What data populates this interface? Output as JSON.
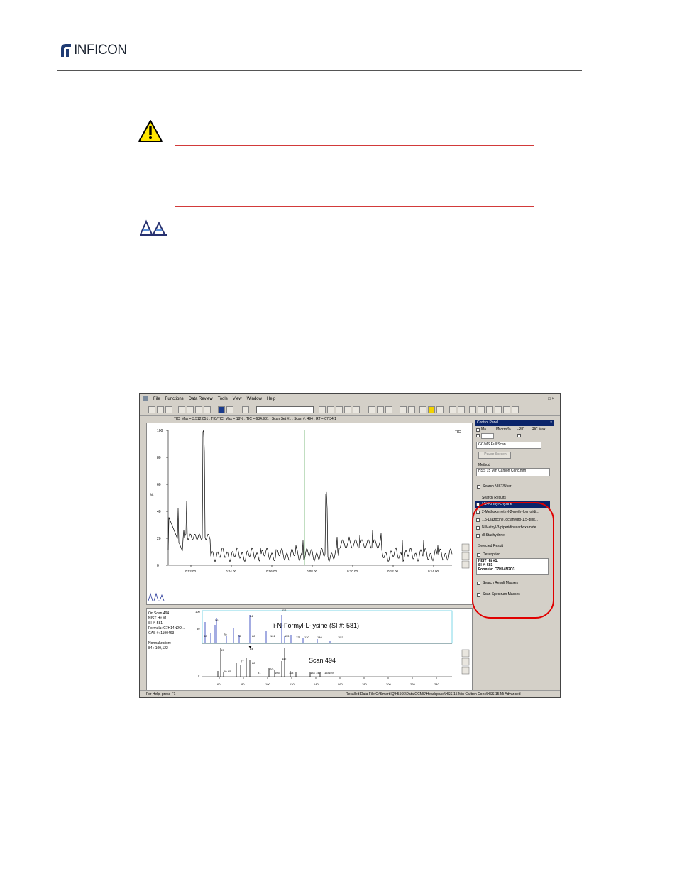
{
  "header": {
    "brand": "INFICON"
  },
  "screenshot": {
    "menu": [
      "File",
      "Functions",
      "Data Review",
      "Tools",
      "View",
      "Window",
      "Help"
    ],
    "tic_info": "TIC_Max = 3,512,051  ;  TIC/TIC_Max = 18%  ;  TIC = 634,981  ;  Scan Set #1  ;  Scan #:  494  ;  RT = 07:34.1",
    "tic_chart": {
      "y_axis_label": "%",
      "y_ticks": [
        "100",
        "80",
        "60",
        "40",
        "20",
        "0"
      ],
      "x_ticks": [
        "0:02.00",
        "0:04.00",
        "0:06.00",
        "0:08.00",
        "0:10.00",
        "0:12.00",
        "0:14.00"
      ],
      "side_label": "TIC"
    },
    "spectrum_info": {
      "lines": [
        "On Scan 494",
        "NIST Hit #1:",
        "SI #: 581",
        "Formula: C7H14N2O...",
        "CAS #: 1190463",
        "",
        "Normalization:",
        " 84 : 109,122"
      ],
      "top_title": "ī-N-Formyl-L-lysine (SI #: 581)",
      "bottom_title": "Scan 494",
      "top_peaks": [
        "84",
        "56",
        "112",
        "40",
        "70",
        "88",
        "101",
        "113",
        "121",
        "130",
        "140",
        "157",
        "76"
      ],
      "bottom_peaks": [
        "69",
        "77",
        "84",
        "88",
        "101",
        "112",
        "91",
        "105",
        "118",
        "134",
        "140",
        "154",
        "159",
        "60",
        "65"
      ],
      "x_ticks": [
        "60",
        "80",
        "100",
        "120",
        "140",
        "160",
        "180",
        "200",
        "220",
        "240"
      ],
      "x_tick_labels": [
        "60",
        "80",
        "100",
        "120",
        "140",
        "154159",
        "176",
        "186",
        "195",
        "207",
        "220",
        "243"
      ],
      "y_ticks": [
        "100",
        "50",
        "0"
      ]
    },
    "control_panel": {
      "title": "Control Panel",
      "col_headers": [
        "Ma...",
        "I/Norm %",
        "-RIC",
        "RIC Max"
      ],
      "scan_mode": "GC/MS Full Scan",
      "pause_button": "Pause Screen",
      "method_label": "Method",
      "method_value": "HSS 15 Min Carbon Conc.mth",
      "search_nist": "Search NIST/User",
      "search_results_label": "Search Results",
      "search_results": [
        "ī-N-Formyl-L-lysine",
        "2-Methoxymethyl-2-methylpyrrolidi...",
        "1,5-Diazocine, octahydro-1,5-dinit...",
        "N-Methyl-3-piperidinecarboxamide",
        "dl-Stachydrine"
      ],
      "selected_result_label": "Selected Result",
      "description_label": "Description",
      "description_text": "NIST Hit #1:\nSI #: 581\nFormula: C7H14N2O3",
      "search_result_masses": "Search Result Masses",
      "scan_spectrum_masses": "Scan Spectrum Masses"
    },
    "status_left": "For Help, press F1",
    "status_right": "Recalled Data File C:\\Smart IQ\\h5566\\Data\\GCMS\\Headspace\\HSS 15 Min Carbon Conc\\HSS 15 Mi Advanced"
  },
  "colors": {
    "accent_red": "#d23a3a",
    "highlight": "#e00000",
    "selection": "#0a246a",
    "tic_marker": "#2f8f2f"
  }
}
